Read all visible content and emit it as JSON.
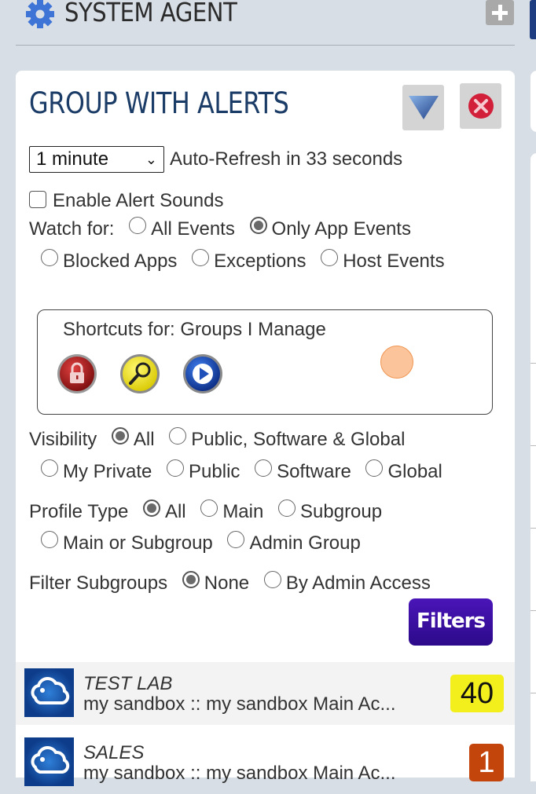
{
  "header": {
    "app_title": "SYSTEM AGENT",
    "icons": {
      "logo": "gear-icon",
      "add": "plus-icon"
    }
  },
  "panel": {
    "title": "GROUP WITH ALERTS",
    "icons": {
      "collapse": "triangle-down-icon",
      "close": "close-circle-icon"
    },
    "refresh": {
      "selected": "1 minute",
      "status": "Auto-Refresh in 33 seconds"
    },
    "alert_sounds": {
      "label": "Enable Alert Sounds",
      "checked": false
    },
    "watch_for": {
      "label": "Watch for:",
      "options": [
        {
          "label": "All Events",
          "selected": false
        },
        {
          "label": "Only App Events",
          "selected": true
        },
        {
          "label": "Blocked Apps",
          "selected": false
        },
        {
          "label": "Exceptions",
          "selected": false
        },
        {
          "label": "Host Events",
          "selected": false
        }
      ]
    },
    "shortcuts": {
      "title": "Shortcuts for: Groups I Manage",
      "icons": [
        "lock-icon",
        "magnifier-icon",
        "play-icon"
      ]
    },
    "visibility": {
      "label": "Visibility",
      "options": [
        {
          "label": "All",
          "selected": true
        },
        {
          "label": "Public, Software & Global",
          "selected": false
        },
        {
          "label": "My Private",
          "selected": false
        },
        {
          "label": "Public",
          "selected": false
        },
        {
          "label": "Software",
          "selected": false
        },
        {
          "label": "Global",
          "selected": false
        }
      ]
    },
    "profile_type": {
      "label": "Profile Type",
      "options": [
        {
          "label": "All",
          "selected": true
        },
        {
          "label": "Main",
          "selected": false
        },
        {
          "label": "Subgroup",
          "selected": false
        },
        {
          "label": "Main or Subgroup",
          "selected": false
        },
        {
          "label": "Admin Group",
          "selected": false
        }
      ]
    },
    "filter_subgroups": {
      "label": "Filter Subgroups",
      "options": [
        {
          "label": "None",
          "selected": true
        },
        {
          "label": "By Admin Access",
          "selected": false
        }
      ]
    },
    "filters_button": "Filters",
    "groups": [
      {
        "name": "TEST LAB",
        "subtitle": "my sandbox :: my sandbox Main Ac...",
        "count": "40",
        "badge_color": "#f3ef1c"
      },
      {
        "name": "SALES",
        "subtitle": "my sandbox :: my sandbox Main Ac...",
        "count": "1",
        "badge_color": "#c4450c"
      }
    ]
  }
}
